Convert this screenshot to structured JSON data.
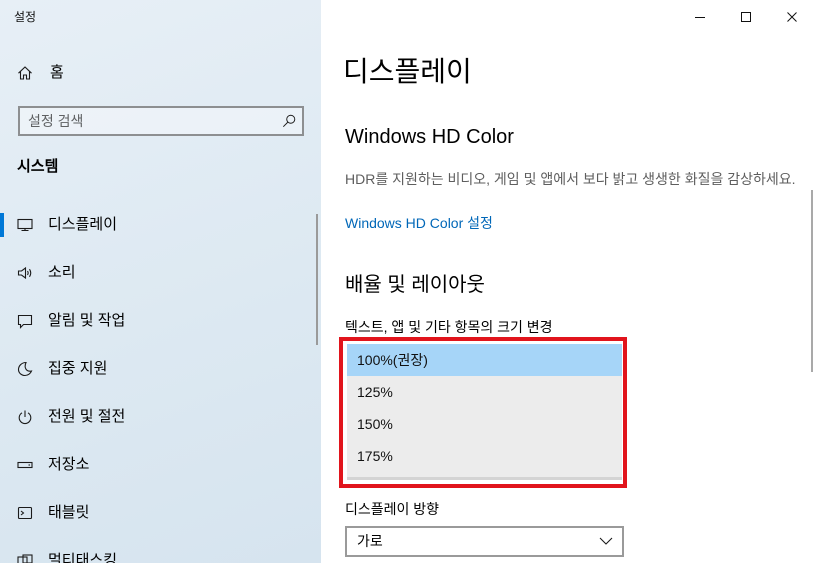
{
  "window": {
    "title": "설정",
    "controls": [
      "minimize-icon",
      "maximize-icon",
      "close-icon"
    ]
  },
  "sidebar": {
    "home": {
      "label": "홈",
      "icon": "home-icon"
    },
    "search": {
      "placeholder": "설정 검색",
      "icon": "search-icon"
    },
    "section_title": "시스템",
    "selected_index": 0,
    "items": [
      {
        "label": "디스플레이",
        "icon": "monitor-icon"
      },
      {
        "label": "소리",
        "icon": "speaker-icon"
      },
      {
        "label": "알림 및 작업",
        "icon": "notification-icon"
      },
      {
        "label": "집중 지원",
        "icon": "moon-icon"
      },
      {
        "label": "전원 및 절전",
        "icon": "power-icon"
      },
      {
        "label": "저장소",
        "icon": "storage-icon"
      },
      {
        "label": "태블릿",
        "icon": "tablet-icon"
      },
      {
        "label": "멀티태스킹",
        "icon": "multitasking-icon"
      }
    ]
  },
  "main": {
    "page_title": "디스플레이",
    "hd_color": {
      "heading": "Windows HD Color",
      "description": "HDR를 지원하는 비디오, 게임 및 앱에서 보다 밝고 생생한 화질을 감상하세요.",
      "link": "Windows HD Color 설정"
    },
    "scale_and_layout": {
      "heading": "배율 및 레이아웃",
      "scale_label": "텍스트, 앱 및 기타 항목의 크기 변경",
      "scale_dropdown": {
        "expanded": true,
        "selected_index": 0,
        "options": [
          "100%(권장)",
          "125%",
          "150%",
          "175%"
        ]
      },
      "orientation_label": "디스플레이 방향",
      "orientation_value": "가로",
      "orientation_icon": "chevron-down-icon"
    }
  },
  "colors": {
    "accent": "#0078d7",
    "link": "#0067b8",
    "highlight": "#a6d5f8",
    "annotation": "#e1141c"
  }
}
